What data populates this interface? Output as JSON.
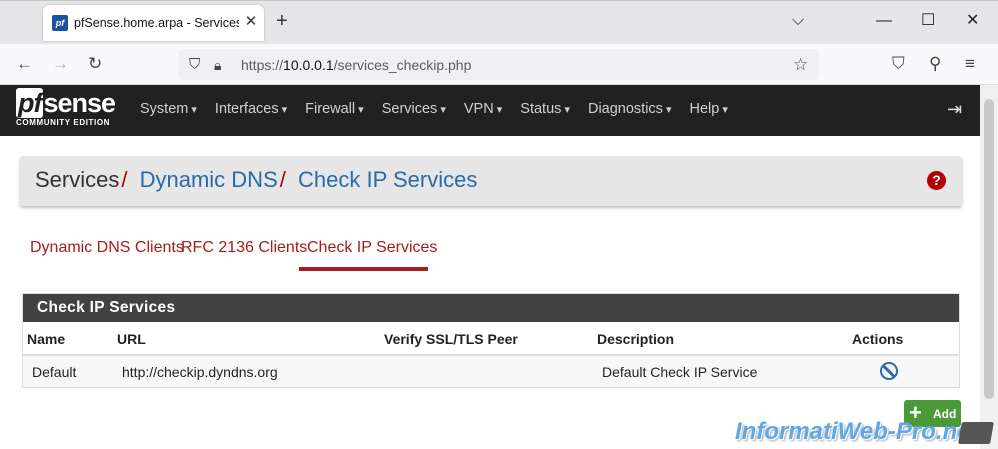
{
  "browser": {
    "tab_title": "pfSense.home.arpa - Services: D",
    "tab_favicon": "pf",
    "url_scheme": "https://",
    "url_host": "10.0.0.1",
    "url_path": "/services_checkip.php"
  },
  "header": {
    "logo_text_pf": "pf",
    "logo_text_sense": "sense",
    "logo_sub": "COMMUNITY EDITION",
    "menu": [
      "System",
      "Interfaces",
      "Firewall",
      "Services",
      "VPN",
      "Status",
      "Diagnostics",
      "Help"
    ]
  },
  "breadcrumb": {
    "part1": "Services",
    "part2": "Dynamic DNS",
    "part3": "Check IP Services",
    "sep": "/",
    "help": "?"
  },
  "tabs": {
    "items": [
      "Dynamic DNS Clients",
      "RFC 2136 Clients",
      "Check IP Services"
    ],
    "active": "Check IP Services"
  },
  "panel": {
    "title": "Check IP Services",
    "columns": [
      "Name",
      "URL",
      "Verify SSL/TLS Peer",
      "Description",
      "Actions"
    ],
    "rows": [
      {
        "name": "Default",
        "url": "http://checkip.dyndns.org",
        "verify": "",
        "description": "Default Check IP Service",
        "action_icon": "ban-icon"
      }
    ]
  },
  "add_button": {
    "label": "Add",
    "icon": "+"
  },
  "watermark": "InformatiWeb-Pro.net",
  "colors": {
    "accent_red": "#a51c1c",
    "link_blue": "#2a6aa8",
    "header_dark": "#212121",
    "add_green": "#4a9a3a"
  }
}
